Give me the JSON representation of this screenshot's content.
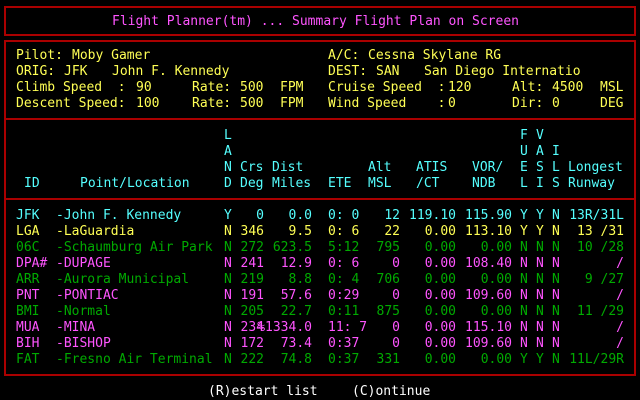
{
  "title": "Flight Planner(tm) ... Summary Flight Plan on Screen",
  "info": {
    "pilot_label": "Pilot:",
    "pilot": "Moby Gamer",
    "ac_label": "A/C:",
    "ac": "Cessna Skylane RG",
    "orig_label": "ORIG:",
    "orig_code": "JFK",
    "orig_name": "John F. Kennedy",
    "dest_label": "DEST:",
    "dest_code": "SAN",
    "dest_name": "San Diego Internatio",
    "climb_label": "Climb Speed  :",
    "climb": "90",
    "climb_rate_label": "Rate:",
    "climb_rate": "500",
    "climb_rate_unit": "FPM",
    "cruise_label": "Cruise Speed  :",
    "cruise": "120",
    "alt_label": "Alt:",
    "alt": "4500",
    "alt_unit": "MSL",
    "descent_label": "Descent Speed:",
    "descent": "100",
    "descent_rate_label": "Rate:",
    "descent_rate": "500",
    "descent_rate_unit": "FPM",
    "wind_label": "Wind Speed    :",
    "wind": "0",
    "dir_label": "Dir:",
    "dir": "0",
    "dir_unit": "DEG"
  },
  "headers": {
    "id": "ID",
    "point": "Point/Location",
    "land": [
      "L",
      "A",
      "N",
      "D"
    ],
    "crs": [
      "Crs",
      "Deg"
    ],
    "dist": [
      "Dist",
      "Miles"
    ],
    "ete": "ETE",
    "alt": [
      "Alt",
      "MSL"
    ],
    "atis": [
      "ATIS",
      "/CT"
    ],
    "vor": [
      "VOR/",
      "NDB"
    ],
    "fuel": [
      "F",
      "U",
      "E",
      "L"
    ],
    "vasi": [
      "V",
      "A",
      "S",
      "I"
    ],
    "ils": [
      "I",
      "L",
      "S"
    ],
    "runway": [
      "Longest",
      "Runway"
    ]
  },
  "rows": [
    {
      "color": "#55ffff",
      "id": "JFK",
      "loc": "-John F. Kennedy",
      "land": "Y",
      "crs": "0",
      "dist": "0.0",
      "ete": "0: 0",
      "alt": "12",
      "atis": "119.10",
      "vor": "115.90",
      "f": "Y",
      "v": "Y",
      "i": "N",
      "rwy": "13R/31L"
    },
    {
      "color": "#ffff55",
      "id": "LGA",
      "loc": "-LaGuardia",
      "land": "N",
      "crs": "346",
      "dist": "9.5",
      "ete": "0: 6",
      "alt": "22",
      "atis": "0.00",
      "vor": "113.10",
      "f": "Y",
      "v": "Y",
      "i": "N",
      "rwy": "13 /31"
    },
    {
      "color": "#00aa00",
      "id": "06C",
      "loc": "-Schaumburg Air Park",
      "land": "N",
      "crs": "272",
      "dist": "623.5",
      "ete": "5:12",
      "alt": "795",
      "atis": "0.00",
      "vor": "0.00",
      "f": "N",
      "v": "N",
      "i": "N",
      "rwy": "10 /28"
    },
    {
      "color": "#ff55ff",
      "id": "DPA#",
      "loc": "-DUPAGE",
      "land": "N",
      "crs": "241",
      "dist": "12.9",
      "ete": "0: 6",
      "alt": "0",
      "atis": "0.00",
      "vor": "108.40",
      "f": "N",
      "v": "N",
      "i": "N",
      "rwy": "/"
    },
    {
      "color": "#00aa00",
      "id": "ARR",
      "loc": "-Aurora Municipal",
      "land": "N",
      "crs": "219",
      "dist": "8.8",
      "ete": "0: 4",
      "alt": "706",
      "atis": "0.00",
      "vor": "0.00",
      "f": "N",
      "v": "N",
      "i": "N",
      "rwy": "9 /27"
    },
    {
      "color": "#ff55ff",
      "id": "PNT",
      "loc": "-PONTIAC",
      "land": "N",
      "crs": "191",
      "dist": "57.6",
      "ete": "0:29",
      "alt": "0",
      "atis": "0.00",
      "vor": "109.60",
      "f": "N",
      "v": "N",
      "i": "N",
      "rwy": "/"
    },
    {
      "color": "#00aa00",
      "id": "BMI",
      "loc": "-Normal",
      "land": "N",
      "crs": "205",
      "dist": "22.7",
      "ete": "0:11",
      "alt": "875",
      "atis": "0.00",
      "vor": "0.00",
      "f": "N",
      "v": "N",
      "i": "N",
      "rwy": "11 /29"
    },
    {
      "color": "#ff55ff",
      "id": "MUA",
      "loc": "-MINA",
      "land": "N",
      "crs": "234",
      "dist": "%1334.0",
      "ete": "11: 7",
      "alt": "0",
      "atis": "0.00",
      "vor": "115.10",
      "f": "N",
      "v": "N",
      "i": "N",
      "rwy": "/"
    },
    {
      "color": "#ff55ff",
      "id": "BIH",
      "loc": "-BISHOP",
      "land": "N",
      "crs": "172",
      "dist": "73.4",
      "ete": "0:37",
      "alt": "0",
      "atis": "0.00",
      "vor": "109.60",
      "f": "N",
      "v": "N",
      "i": "N",
      "rwy": "/"
    },
    {
      "color": "#00aa00",
      "id": "FAT",
      "loc": "-Fresno Air Terminal",
      "land": "N",
      "crs": "222",
      "dist": "74.8",
      "ete": "0:37",
      "alt": "331",
      "atis": "0.00",
      "vor": "0.00",
      "f": "Y",
      "v": "Y",
      "i": "N",
      "rwy": "11L/29R"
    }
  ],
  "footer": {
    "restart": "(R)estart list",
    "continue": "(C)ontinue"
  }
}
